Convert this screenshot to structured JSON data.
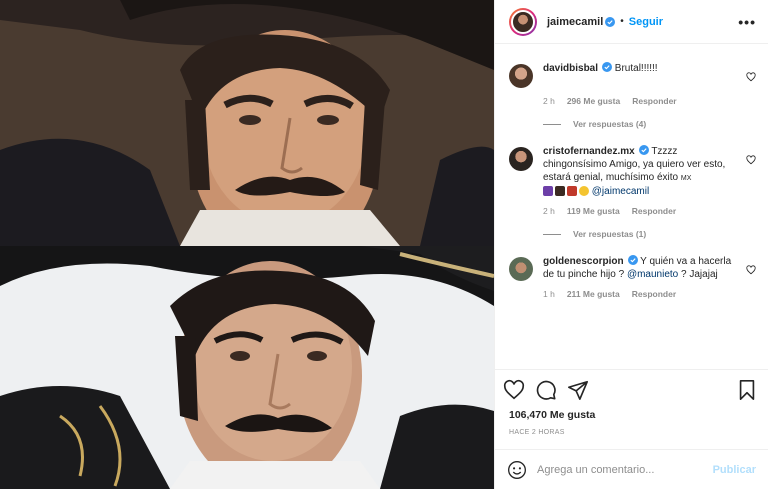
{
  "post": {
    "author": {
      "username": "jaimecamil",
      "verified": true,
      "follow_label": "Seguir",
      "separator": "•",
      "more_label": "•••"
    },
    "comments": [
      {
        "username": "davidbisbal",
        "verified": true,
        "text": "Brutal!!!!!!",
        "time": "2 h",
        "likes": "296 Me gusta",
        "reply_label": "Responder",
        "replies_label": "Ver respuestas (4)"
      },
      {
        "username": "cristofernandez.mx",
        "verified": true,
        "text": "Tzzzz chingonsísimo Amigo, ya quiero ver esto, estará genial, muchísimo éxito",
        "text_tail": "MX",
        "mention": "@jaimecamil",
        "time": "2 h",
        "likes": "119 Me gusta",
        "reply_label": "Responder",
        "replies_label": "Ver respuestas (1)"
      },
      {
        "username": "goldenescorpion",
        "verified": true,
        "text": "Y quién va a hacerla de tu pinche hijo ?",
        "mention": "@maunieto",
        "text_after": "? Jajajaj",
        "time": "1 h",
        "likes": "211 Me gusta",
        "reply_label": "Responder"
      }
    ],
    "likes_count": "106,470 Me gusta",
    "time_ago": "HACE 2 HORAS",
    "comment_input": {
      "placeholder": "Agrega un comentario...",
      "value": ""
    },
    "publish_label": "Publicar"
  },
  "colors": {
    "accent": "#0095f6",
    "publish_disabled": "#b2dffc",
    "secondary_text": "#8e8e8e",
    "mention": "#00376b"
  },
  "icons": {
    "like": "heart-icon",
    "comment": "comment-icon",
    "share": "share-icon",
    "save": "bookmark-icon",
    "emoji": "emoji-icon",
    "verified": "verified-badge-icon"
  }
}
